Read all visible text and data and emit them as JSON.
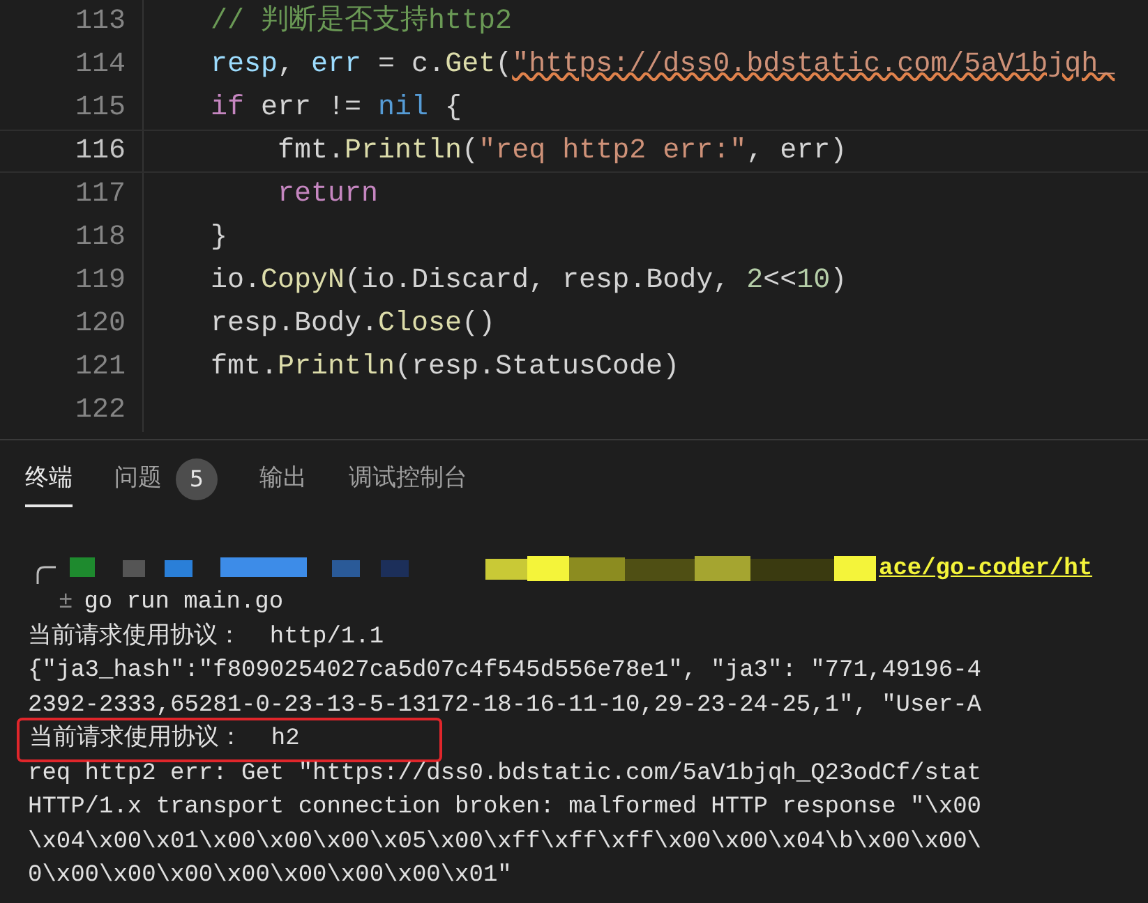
{
  "editor": {
    "lines": [
      {
        "number": "113",
        "active": false,
        "tokens": [
          {
            "kind": "comment",
            "text": "    // 判断是否支持http2"
          }
        ]
      },
      {
        "number": "114",
        "active": false,
        "tokens": [
          {
            "kind": "var",
            "text": "    resp"
          },
          {
            "kind": "plain",
            "text": ", "
          },
          {
            "kind": "var",
            "text": "err"
          },
          {
            "kind": "plain",
            "text": " = c."
          },
          {
            "kind": "func",
            "text": "Get"
          },
          {
            "kind": "plain",
            "text": "("
          },
          {
            "kind": "error_string",
            "text": "\"https://dss0.bdstatic.com/5aV1bjqh_"
          }
        ]
      },
      {
        "number": "115",
        "active": false,
        "tokens": [
          {
            "kind": "keyword",
            "text": "    if"
          },
          {
            "kind": "plain",
            "text": " err != "
          },
          {
            "kind": "constant",
            "text": "nil"
          },
          {
            "kind": "plain",
            "text": " {"
          }
        ]
      },
      {
        "number": "116",
        "active": true,
        "tokens": [
          {
            "kind": "plain",
            "text": "        fmt."
          },
          {
            "kind": "func",
            "text": "Println"
          },
          {
            "kind": "plain",
            "text": "("
          },
          {
            "kind": "string",
            "text": "\"req http2 err:\""
          },
          {
            "kind": "plain",
            "text": ", err)"
          }
        ]
      },
      {
        "number": "117",
        "active": false,
        "tokens": [
          {
            "kind": "keyword",
            "text": "        return"
          }
        ]
      },
      {
        "number": "118",
        "active": false,
        "tokens": [
          {
            "kind": "plain",
            "text": "    }"
          }
        ]
      },
      {
        "number": "119",
        "active": false,
        "tokens": [
          {
            "kind": "plain",
            "text": "    io."
          },
          {
            "kind": "func",
            "text": "CopyN"
          },
          {
            "kind": "plain",
            "text": "(io.Discard, resp.Body, "
          },
          {
            "kind": "number",
            "text": "2"
          },
          {
            "kind": "plain",
            "text": "<<"
          },
          {
            "kind": "number",
            "text": "10"
          },
          {
            "kind": "plain",
            "text": ")"
          }
        ]
      },
      {
        "number": "120",
        "active": false,
        "tokens": [
          {
            "kind": "plain",
            "text": "    resp.Body."
          },
          {
            "kind": "func",
            "text": "Close"
          },
          {
            "kind": "plain",
            "text": "()"
          }
        ]
      },
      {
        "number": "121",
        "active": false,
        "tokens": [
          {
            "kind": "plain",
            "text": "    fmt."
          },
          {
            "kind": "func",
            "text": "Println"
          },
          {
            "kind": "plain",
            "text": "(resp.StatusCode)"
          }
        ]
      },
      {
        "number": "122",
        "active": false
      }
    ]
  },
  "panel": {
    "tabs": [
      {
        "label": "终端",
        "selected": true
      },
      {
        "label": "问题",
        "selected": false,
        "badge": "5"
      },
      {
        "label": "输出",
        "selected": false
      },
      {
        "label": "调试控制台",
        "selected": false
      }
    ]
  },
  "terminal": {
    "lines": [
      {
        "kind": "prompt",
        "path": "ace/go-coder/ht"
      },
      {
        "kind": "command",
        "symbol": "±",
        "text": "go run main.go"
      },
      {
        "kind": "output",
        "text": "当前请求使用协议：  http/1.1"
      },
      {
        "kind": "output",
        "text": "{\"ja3_hash\":\"f8090254027ca5d07c4f545d556e78e1\", \"ja3\": \"771,49196-4"
      },
      {
        "kind": "output",
        "text": "2392-2333,65281-0-23-13-5-13172-18-16-11-10,29-23-24-25,1\", \"User-A"
      },
      {
        "kind": "highlighted",
        "text": "当前请求使用协议：  h2"
      },
      {
        "kind": "output",
        "text": "req http2 err: Get \"https://dss0.bdstatic.com/5aV1bjqh_Q23odCf/stat"
      },
      {
        "kind": "output",
        "text": "HTTP/1.x transport connection broken: malformed HTTP response \"\\x00"
      },
      {
        "kind": "output",
        "text": "\\x04\\x00\\x01\\x00\\x00\\x00\\x05\\x00\\xff\\xff\\xff\\x00\\x00\\x04\\b\\x00\\x00\\"
      },
      {
        "kind": "output",
        "text": "0\\x00\\x00\\x00\\x00\\x00\\x00\\x00\\x01\""
      }
    ]
  }
}
